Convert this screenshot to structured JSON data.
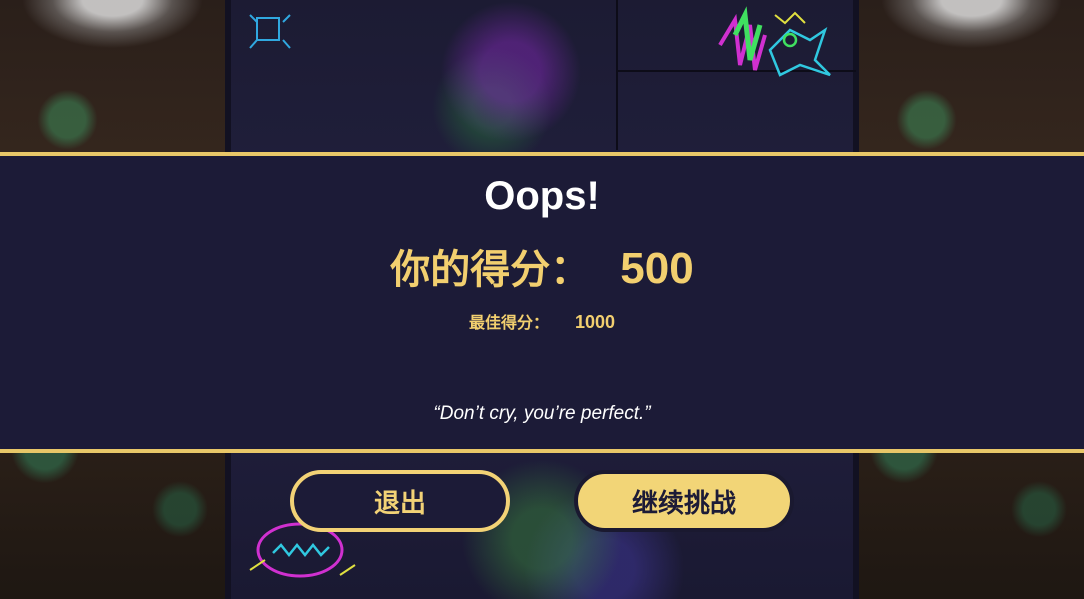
{
  "result": {
    "title": "Oops!",
    "score_label": "你的得分：",
    "score_value": "500",
    "best_label": "最佳得分：",
    "best_value": "1000",
    "quote": "“Don’t cry, you’re perfect.”"
  },
  "buttons": {
    "quit_label": "退出",
    "continue_label": "继续挑战"
  },
  "colors": {
    "banner_bg": "#1c1b37",
    "gold": "#f2cf6f",
    "button_fill": "#f2d577",
    "text_white": "#ffffff"
  },
  "icons": [
    "neon-doodle-monster-icon",
    "neon-doodle-grin-icon"
  ]
}
